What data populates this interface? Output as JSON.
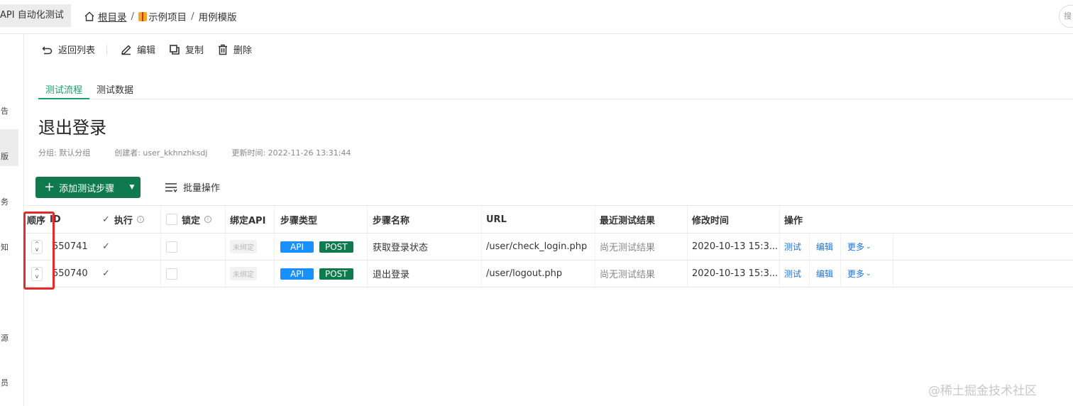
{
  "header": {
    "app_title": "API 自动化测试",
    "breadcrumb": {
      "root": "根目录",
      "project": "示例项目",
      "current": "用例模版"
    },
    "right_button": "搜"
  },
  "sidebar": {
    "items": [
      "告",
      "版",
      "务",
      "知",
      "源",
      "员"
    ]
  },
  "toolbar": {
    "back": "返回列表",
    "edit": "编辑",
    "copy": "复制",
    "delete": "删除"
  },
  "tabs": [
    "测试流程",
    "测试数据"
  ],
  "page": {
    "title": "退出登录",
    "group": "分组: 默认分组",
    "creator": "创建者: user_kkhnzhksdj",
    "updated": "更新时间: 2022-11-26 13:31:44"
  },
  "actions": {
    "add_step": "添加测试步骤",
    "batch": "批量操作"
  },
  "table": {
    "headers": {
      "order": "顺序",
      "id": "ID",
      "execute": "执行",
      "lock": "锁定",
      "bind_api": "绑定API",
      "step_type": "步骤类型",
      "step_name": "步骤名称",
      "url": "URL",
      "last_result": "最近测试结果",
      "modified": "修改时间",
      "ops": "操作"
    },
    "rows": [
      {
        "id": "550741",
        "bind": "未绑定",
        "type1": "API",
        "type2": "POST",
        "name": "获取登录状态",
        "url": "/user/check_login.php",
        "result": "尚无测试结果",
        "modified": "2020-10-13 15:3...",
        "op_test": "测试",
        "op_edit": "编辑",
        "op_more": "更多"
      },
      {
        "id": "550740",
        "bind": "未绑定",
        "type1": "API",
        "type2": "POST",
        "name": "退出登录",
        "url": "/user/logout.php",
        "result": "尚无测试结果",
        "modified": "2020-10-13 15:3...",
        "op_test": "测试",
        "op_edit": "编辑",
        "op_more": "更多"
      }
    ]
  },
  "watermark": "@稀土掘金技术社区",
  "colors": {
    "primary_green": "#0f7a4e",
    "tab_green": "#1a9e6a",
    "api_blue": "#1890ff",
    "highlight_red": "#e32b2b"
  }
}
